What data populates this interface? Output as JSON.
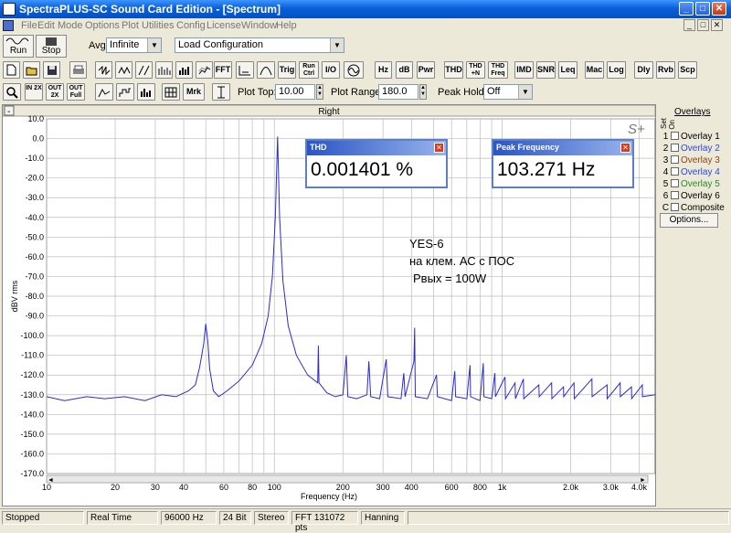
{
  "window": {
    "title": "SpectraPLUS-SC Sound Card Edition - [Spectrum]",
    "min": "_",
    "max": "□",
    "close": "✕"
  },
  "menu": [
    "File",
    "Edit",
    "Mode",
    "Options",
    "Plot",
    "Utilities",
    "Config",
    "License",
    "Window",
    "Help"
  ],
  "toolbar": {
    "run_label": "Run",
    "stop_label": "Stop",
    "avg_label": "Avg",
    "avg_value": "Infinite",
    "config_value": "Load Configuration",
    "row2": [
      "FFT",
      "Trig",
      "Run Ctrl",
      "I/O",
      "Hz",
      "dB",
      "Pwr",
      "THD",
      "THD +N",
      "THD Freq",
      "IMD",
      "SNR",
      "Leq",
      "Mac",
      "Log",
      "Dly",
      "Rvb",
      "Scp"
    ],
    "row3": [
      "IN 2X",
      "OUT 2X",
      "OUT Full",
      "Mrk"
    ],
    "plot_top_label": "Plot Top:",
    "plot_top_value": "10.00",
    "plot_range_label": "Plot Range:",
    "plot_range_value": "180.0",
    "peak_hold_label": "Peak Hold:",
    "peak_hold_value": "Off"
  },
  "plot": {
    "channel_title": "Right",
    "logo": "S+",
    "minimize": "-",
    "scroll_plus": "+",
    "scroll_left": "◄",
    "scroll_right": "►"
  },
  "readouts": {
    "thd": {
      "title": "THD",
      "value": "0.001401 %"
    },
    "peak": {
      "title": "Peak Frequency",
      "value": "103.271 Hz"
    }
  },
  "annotation": {
    "line1": "YES-6",
    "line2": "на клем. АС с ПОС",
    "line3": "Рвых = 100W"
  },
  "sidebar": {
    "title": "Overlays",
    "col_set": "Set",
    "col_on": "On",
    "items": [
      {
        "num": "1",
        "label": "Overlay 1",
        "color": "#000000"
      },
      {
        "num": "2",
        "label": "Overlay 2",
        "color": "#2a48e0"
      },
      {
        "num": "3",
        "label": "Overlay 3",
        "color": "#8b4513"
      },
      {
        "num": "4",
        "label": "Overlay 4",
        "color": "#2a48e0"
      },
      {
        "num": "5",
        "label": "Overlay 5",
        "color": "#2a8a2a"
      },
      {
        "num": "6",
        "label": "Overlay 6",
        "color": "#000000"
      },
      {
        "num": "C",
        "label": "Composite",
        "color": "#000000"
      }
    ],
    "options_label": "Options..."
  },
  "status": [
    "Stopped",
    "Real Time",
    "96000 Hz",
    "24 Bit",
    "Stereo",
    "FFT 131072 pts",
    "Hanning"
  ],
  "chart_data": {
    "type": "line",
    "title": "Right",
    "xlabel": "Frequency (Hz)",
    "ylabel": "dBV rms",
    "x_scale": "log",
    "xlim": [
      10,
      4700
    ],
    "ylim": [
      -170,
      10
    ],
    "y_ticks": [
      10,
      0,
      -10,
      -20,
      -30,
      -40,
      -50,
      -60,
      -70,
      -80,
      -90,
      -100,
      -110,
      -120,
      -130,
      -140,
      -150,
      -160,
      -170
    ],
    "x_tick_labels": [
      {
        "v": 10,
        "t": "10"
      },
      {
        "v": 20,
        "t": "20"
      },
      {
        "v": 30,
        "t": "30"
      },
      {
        "v": 40,
        "t": "40"
      },
      {
        "v": 60,
        "t": "60"
      },
      {
        "v": 80,
        "t": "80"
      },
      {
        "v": 100,
        "t": "100"
      },
      {
        "v": 200,
        "t": "200"
      },
      {
        "v": 300,
        "t": "300"
      },
      {
        "v": 400,
        "t": "400"
      },
      {
        "v": 600,
        "t": "600"
      },
      {
        "v": 800,
        "t": "800"
      },
      {
        "v": 1000,
        "t": "1k"
      },
      {
        "v": 2000,
        "t": "2.0k"
      },
      {
        "v": 3000,
        "t": "3.0k"
      },
      {
        "v": 4000,
        "t": "4.0k"
      }
    ],
    "grid": true,
    "series": [
      {
        "color": "#2a2ad8",
        "points": [
          [
            10,
            -131
          ],
          [
            12,
            -133
          ],
          [
            15,
            -131
          ],
          [
            18,
            -132
          ],
          [
            22,
            -131
          ],
          [
            27,
            -133
          ],
          [
            32,
            -130
          ],
          [
            37,
            -131
          ],
          [
            42,
            -128
          ],
          [
            45,
            -125
          ],
          [
            47,
            -116
          ],
          [
            49,
            -104
          ],
          [
            50,
            -94
          ],
          [
            51,
            -103
          ],
          [
            52,
            -117
          ],
          [
            54,
            -128
          ],
          [
            57,
            -131
          ],
          [
            62,
            -128
          ],
          [
            70,
            -123
          ],
          [
            80,
            -115
          ],
          [
            88,
            -104
          ],
          [
            94,
            -90
          ],
          [
            98,
            -70
          ],
          [
            101,
            -40
          ],
          [
            103.3,
            1
          ],
          [
            105.5,
            -40
          ],
          [
            109,
            -72
          ],
          [
            115,
            -95
          ],
          [
            125,
            -110
          ],
          [
            140,
            -120
          ],
          [
            155,
            -124
          ],
          [
            156,
            -105
          ],
          [
            157,
            -124
          ],
          [
            170,
            -129
          ],
          [
            185,
            -131
          ],
          [
            200,
            -130
          ],
          [
            207,
            -110
          ],
          [
            210,
            -131
          ],
          [
            230,
            -132
          ],
          [
            255,
            -130
          ],
          [
            260,
            -113
          ],
          [
            265,
            -131
          ],
          [
            290,
            -132
          ],
          [
            310,
            -112
          ],
          [
            315,
            -131
          ],
          [
            360,
            -132
          ],
          [
            370,
            -119
          ],
          [
            375,
            -131
          ],
          [
            410,
            -113
          ],
          [
            413,
            -96
          ],
          [
            416,
            -131
          ],
          [
            470,
            -132
          ],
          [
            515,
            -120
          ],
          [
            520,
            -131
          ],
          [
            600,
            -133
          ],
          [
            620,
            -118
          ],
          [
            625,
            -131
          ],
          [
            700,
            -132
          ],
          [
            723,
            -115
          ],
          [
            727,
            -131
          ],
          [
            800,
            -133
          ],
          [
            827,
            -114
          ],
          [
            832,
            -131
          ],
          [
            900,
            -132
          ],
          [
            930,
            -119
          ],
          [
            935,
            -131
          ],
          [
            1030,
            -121
          ],
          [
            1035,
            -132
          ],
          [
            1140,
            -124
          ],
          [
            1145,
            -132
          ],
          [
            1240,
            -122
          ],
          [
            1245,
            -132
          ],
          [
            1450,
            -125
          ],
          [
            1455,
            -131
          ],
          [
            1650,
            -124
          ],
          [
            1655,
            -132
          ],
          [
            1860,
            -126
          ],
          [
            1865,
            -131
          ],
          [
            2070,
            -124
          ],
          [
            2075,
            -132
          ],
          [
            2480,
            -122
          ],
          [
            2485,
            -131
          ],
          [
            2890,
            -125
          ],
          [
            2895,
            -132
          ],
          [
            3300,
            -124
          ],
          [
            3305,
            -131
          ],
          [
            3700,
            -126
          ],
          [
            3705,
            -132
          ],
          [
            4130,
            -125
          ],
          [
            4135,
            -131
          ],
          [
            4700,
            -130
          ]
        ]
      }
    ]
  }
}
